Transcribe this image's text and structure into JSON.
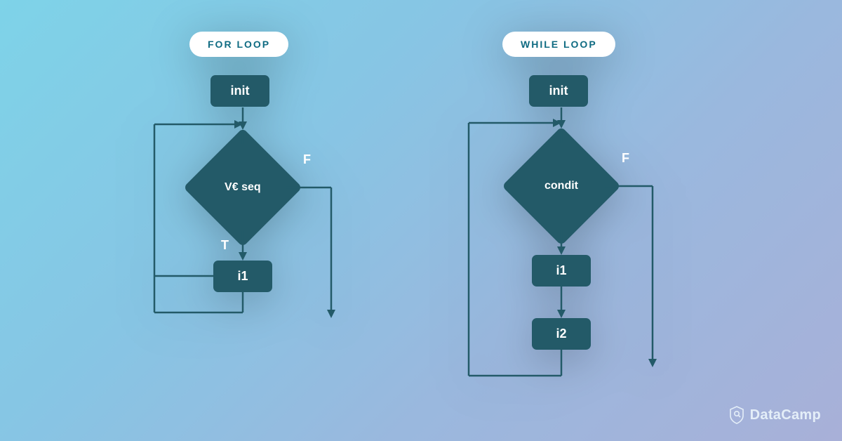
{
  "for_loop": {
    "title": "FOR LOOP",
    "init": "init",
    "condition": "V€ seq",
    "true_label": "T",
    "false_label": "F",
    "step1": "i1"
  },
  "while_loop": {
    "title": "WHILE LOOP",
    "init": "init",
    "condition": "condit",
    "false_label": "F",
    "step1": "i1",
    "step2": "i2"
  },
  "brand": "DataCamp"
}
